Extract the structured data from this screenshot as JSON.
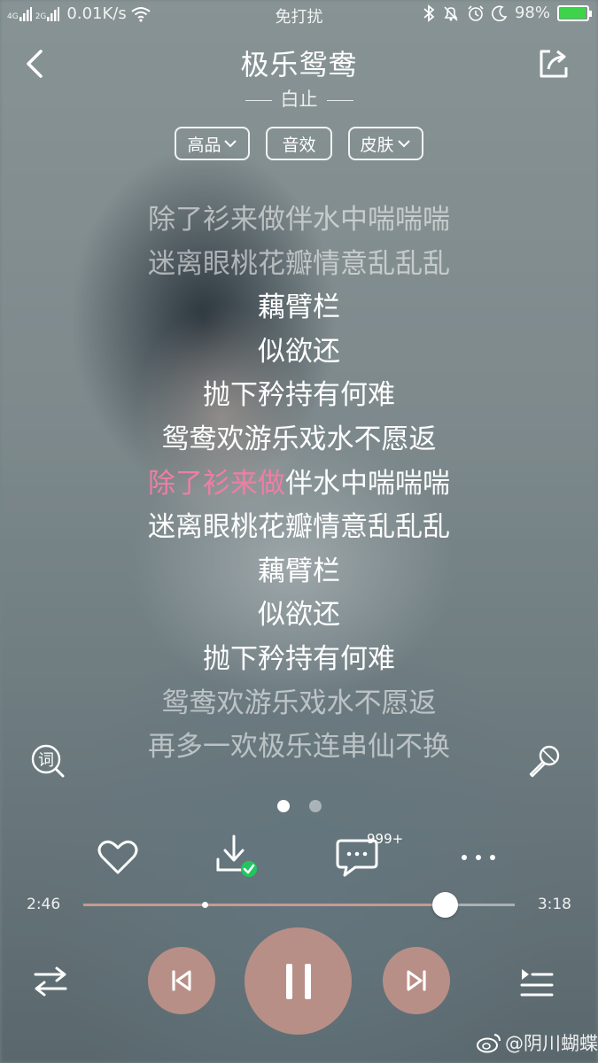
{
  "status_bar": {
    "network_labels": [
      "4G",
      "2G"
    ],
    "speed": "0.01K/s",
    "mode": "免打扰",
    "battery": "98%",
    "battery_level": 0.98
  },
  "header": {
    "title": "极乐鸳鸯",
    "artist": "白止"
  },
  "chips": [
    {
      "label": "高品",
      "has_dropdown": true
    },
    {
      "label": "音效",
      "has_dropdown": false
    },
    {
      "label": "皮肤",
      "has_dropdown": true
    }
  ],
  "lyrics": [
    {
      "text": "除了衫来做伴水中喘喘喘",
      "state": "dim"
    },
    {
      "text": "迷离眼桃花瓣情意乱乱乱",
      "state": "dim"
    },
    {
      "text": "藕臂栏",
      "state": "normal"
    },
    {
      "text": "似欲还",
      "state": "normal"
    },
    {
      "text": "抛下矜持有何难",
      "state": "normal"
    },
    {
      "text": "鸳鸯欢游乐戏水不愿返",
      "state": "normal"
    },
    {
      "sung": "除了衫来做",
      "rest": "伴水中喘喘喘",
      "state": "current"
    },
    {
      "text": "迷离眼桃花瓣情意乱乱乱",
      "state": "normal"
    },
    {
      "text": "藕臂栏",
      "state": "normal"
    },
    {
      "text": "似欲还",
      "state": "normal"
    },
    {
      "text": "抛下矜持有何难",
      "state": "normal"
    },
    {
      "text": "鸳鸯欢游乐戏水不愿返",
      "state": "dim"
    },
    {
      "text": "再多一欢极乐连串仙不换",
      "state": "dim"
    }
  ],
  "lyric_mode_label": "词",
  "pager": {
    "count": 2,
    "active": 0
  },
  "actions": {
    "comment_count": "999+",
    "icons": [
      "heart-icon",
      "download-icon",
      "comment-icon",
      "more-icon"
    ]
  },
  "playback": {
    "current_time": "2:46",
    "total_time": "3:18",
    "progress": 0.838,
    "buffer_marker": 0.283
  },
  "colors": {
    "accent": "#ef7ea3",
    "button": "#b88f87",
    "download_done": "#22c55e"
  },
  "watermark": "@阴川蝴蝶"
}
